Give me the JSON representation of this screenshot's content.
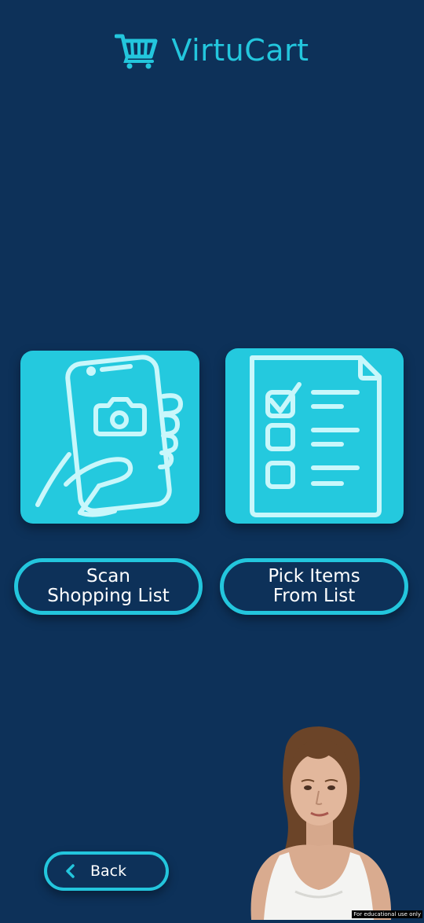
{
  "header": {
    "title": "VirtuCart",
    "logo_icon": "shopping-cart-icon"
  },
  "tiles": [
    {
      "icon": "phone-camera-scan-icon",
      "label": "Scan\nShopping List"
    },
    {
      "icon": "checklist-document-icon",
      "label": "Pick Items\nFrom List"
    }
  ],
  "back": {
    "icon": "chevron-left-icon",
    "label": "Back"
  },
  "watermark": "For educational use only",
  "colors": {
    "background": "#0d3159",
    "accent": "#24c9de",
    "icon_stroke": "#c9f7fb",
    "text": "#ffffff"
  }
}
